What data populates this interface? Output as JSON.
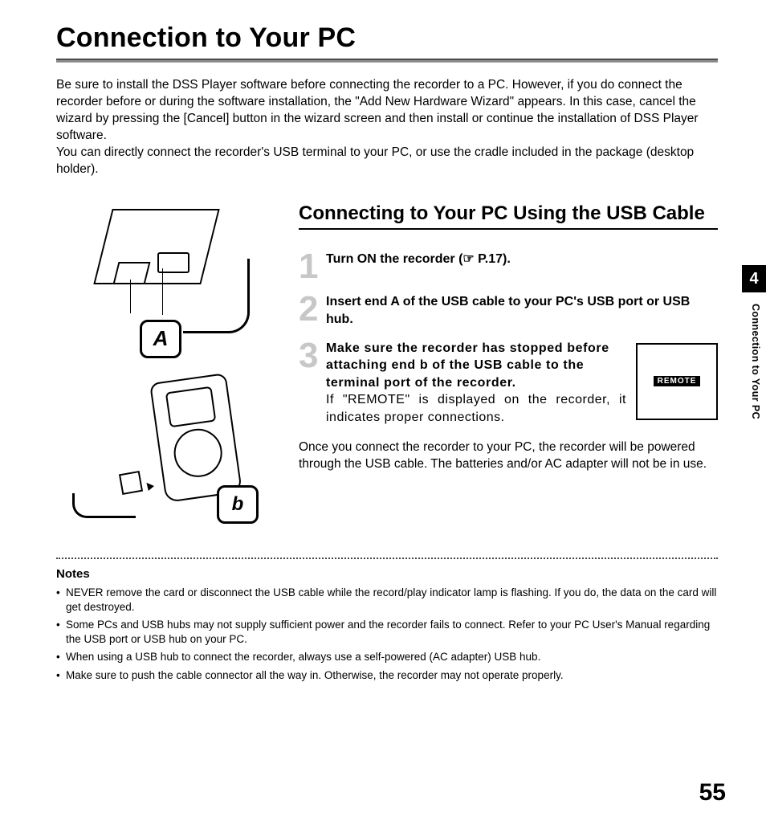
{
  "title": "Connection to Your PC",
  "intro": "Be sure to install the DSS Player software before connecting the recorder to a PC. However, if you do connect the recorder before or during the software installation, the \"Add New Hardware Wizard\" appears. In this case, cancel the wizard by pressing the [Cancel] button in the wizard screen and then install or continue the installation of DSS Player software.\nYou can directly connect the recorder's USB terminal to your PC, or use the cradle included in the package (desktop holder).",
  "subtitle": "Connecting to Your PC Using the USB Cable",
  "steps": [
    {
      "n": "1",
      "bold": "Turn ON the recorder (☞ P.17)."
    },
    {
      "n": "2",
      "bold": "Insert end A of the USB cable to your PC's USB port or USB hub."
    },
    {
      "n": "3",
      "bold": "Make sure the recorder has stopped before attaching end b of the USB cable to the terminal port of the recorder.",
      "tail": "If \"REMOTE\" is displayed on the recorder, it indicates proper connections."
    }
  ],
  "remote_label": "REMOTE",
  "once": "Once you connect the recorder to your PC, the recorder will be powered through the USB cable. The batteries and/or AC adapter will not be in use.",
  "notes_heading": "Notes",
  "notes": [
    "NEVER remove the card or disconnect the USB cable while the record/play indicator lamp is flashing. If you do, the data on the card will get destroyed.",
    "Some PCs and USB hubs may not supply sufficient power and the recorder fails to connect. Refer to your PC User's Manual regarding the USB port or USB hub on your PC.",
    "When using a USB hub to connect the recorder, always use a self-powered (AC adapter) USB hub.",
    "Make sure to push the cable connector all the way in. Otherwise, the recorder may not operate properly."
  ],
  "tab": "4",
  "side_text": "Connection to Your PC",
  "page_number": "55",
  "badge_a": "A",
  "badge_b": "b"
}
